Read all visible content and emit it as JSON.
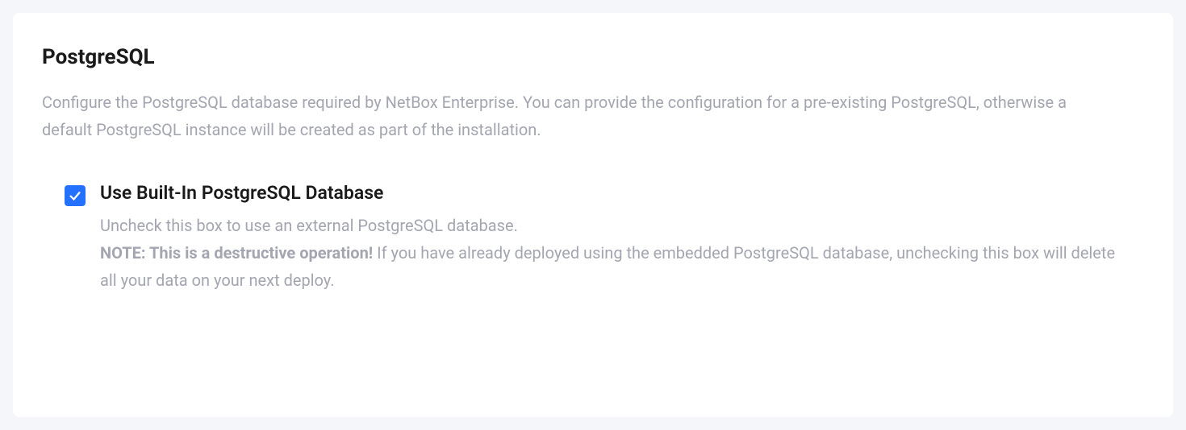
{
  "section": {
    "title": "PostgreSQL",
    "description": "Configure the PostgreSQL database required by NetBox Enterprise. You can provide the configuration for a pre-existing PostgreSQL, otherwise a default PostgreSQL instance will be created as part of the installation."
  },
  "option": {
    "checked": true,
    "label": "Use Built-In PostgreSQL Database",
    "help_line1": "Uncheck this box to use an external PostgreSQL database.",
    "note_bold": "NOTE: This is a destructive operation!",
    "note_rest": " If you have already deployed using the embedded PostgreSQL database, unchecking this box will delete all your data on your next deploy."
  }
}
